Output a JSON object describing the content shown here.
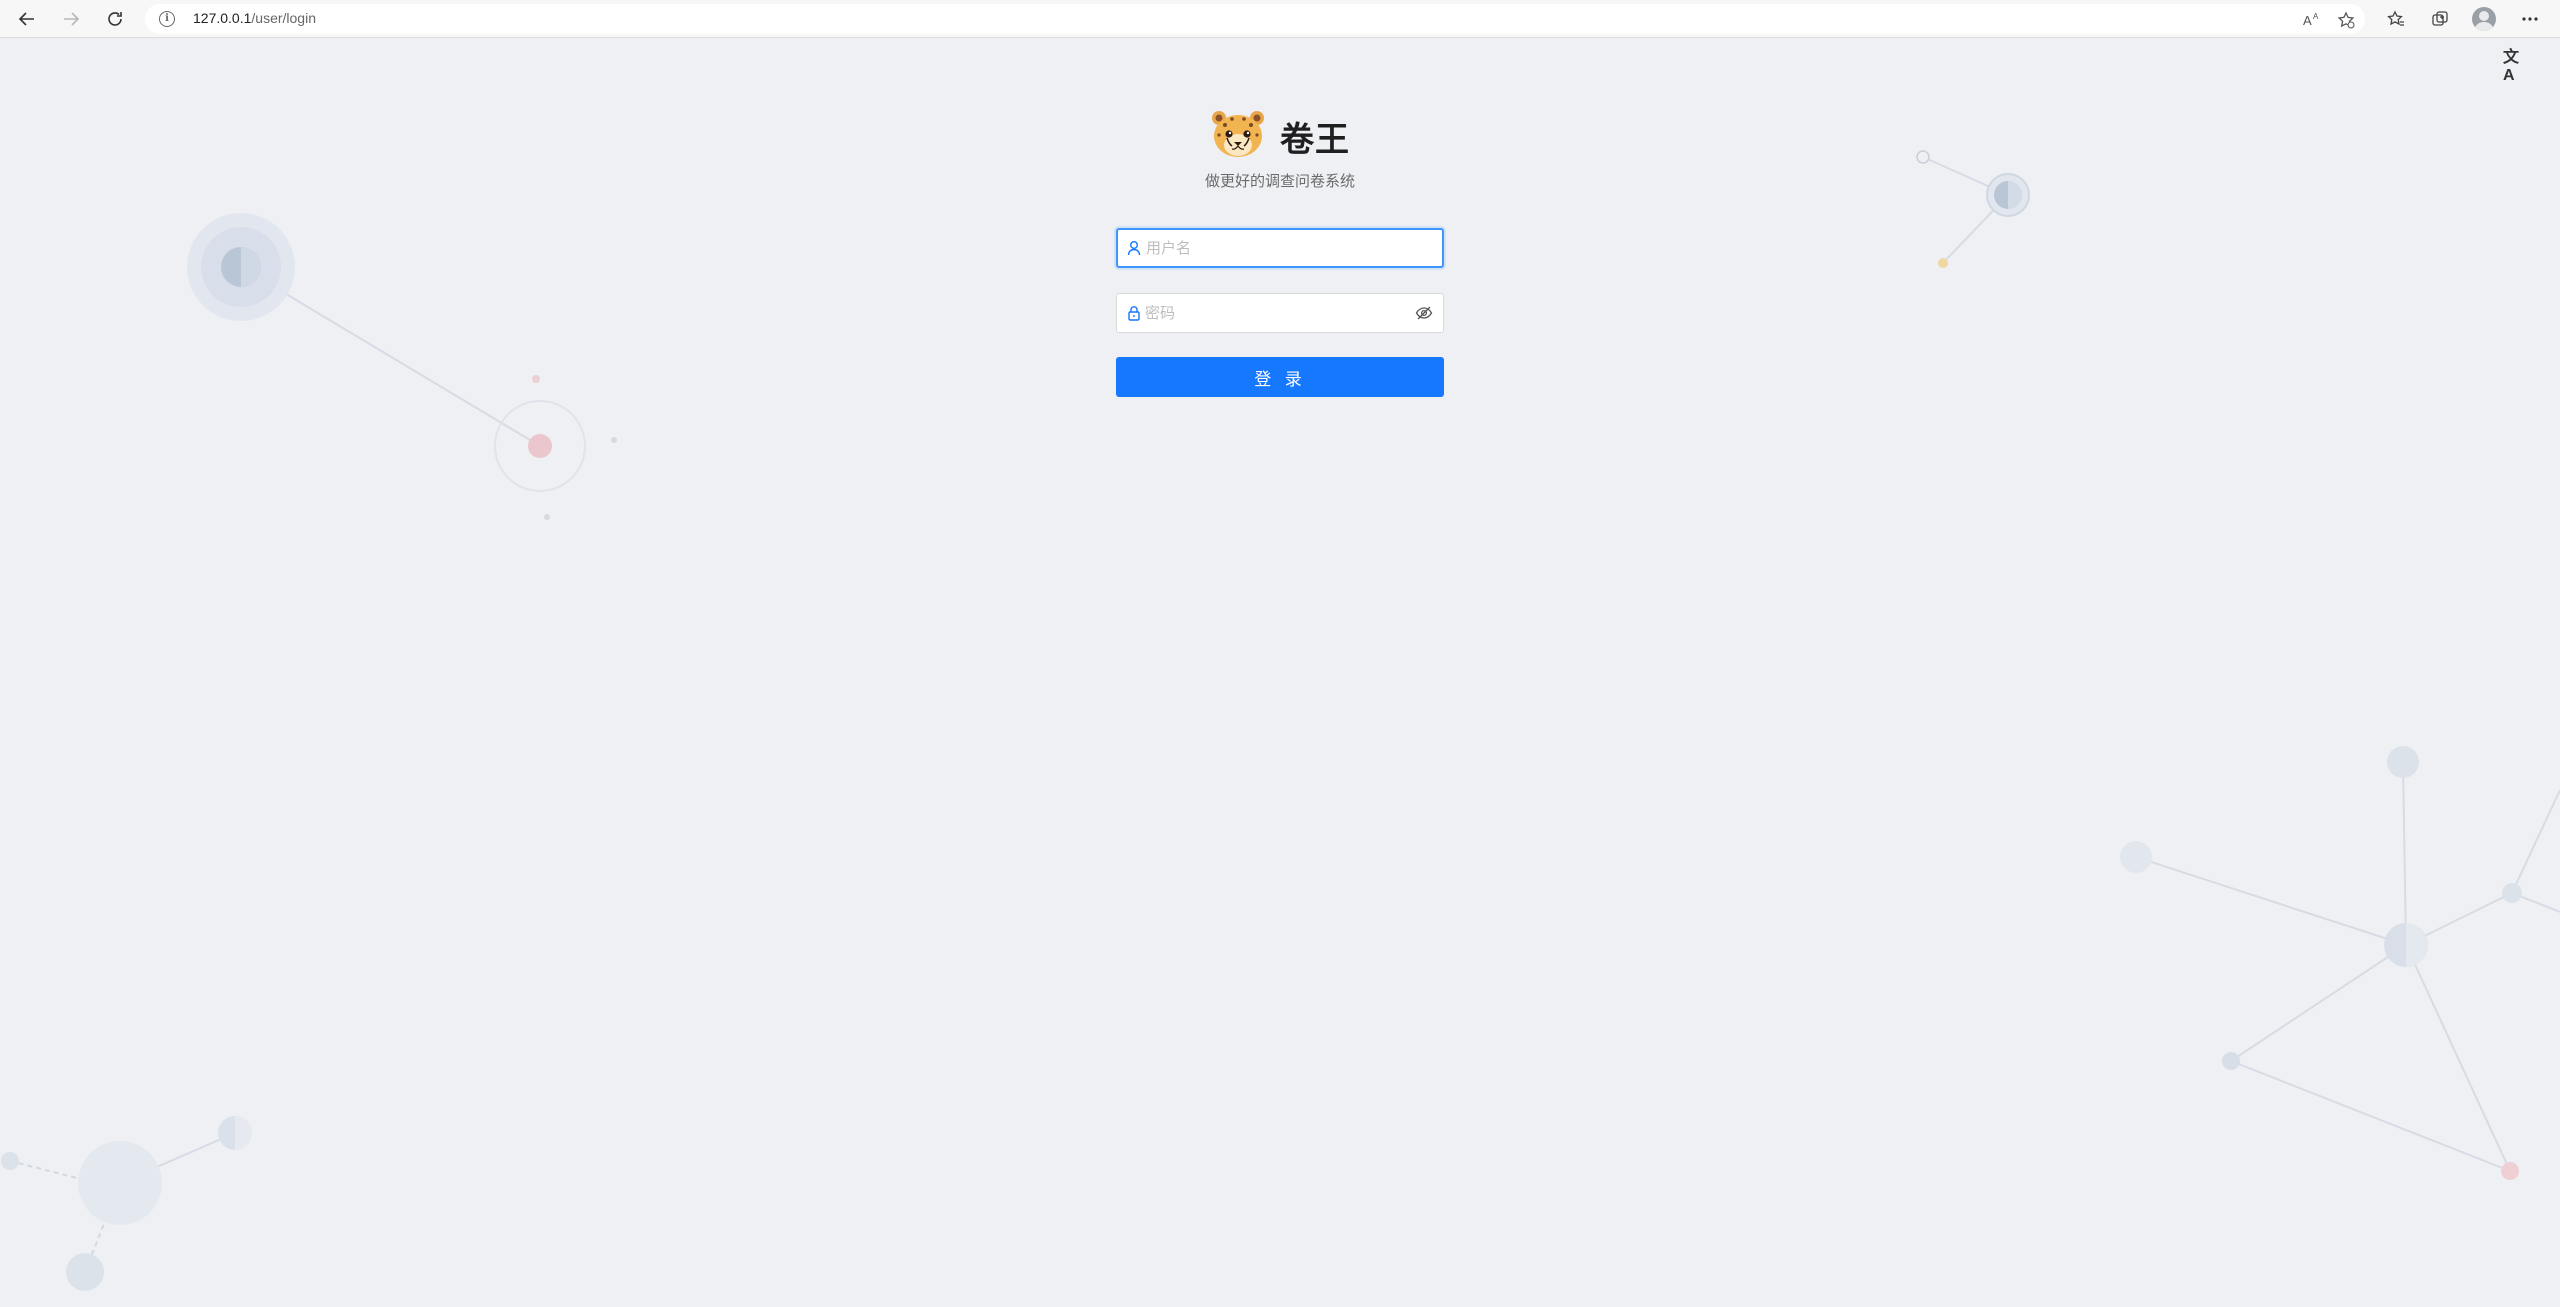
{
  "browser": {
    "url_host": "127.0.0.1",
    "url_path": "/user/login",
    "icons": [
      "back-icon",
      "forward-icon",
      "reload-icon",
      "info-icon",
      "read-aloud-icon",
      "add-favorite-icon",
      "favorites-icon",
      "collections-icon",
      "profile-avatar",
      "more-icon"
    ]
  },
  "page": {
    "translate_label": "文A",
    "brand": {
      "title": "卷王",
      "logo": "cheetah-logo"
    },
    "subtitle": "做更好的调查问卷系统",
    "username": {
      "placeholder": "用户名",
      "value": ""
    },
    "password": {
      "placeholder": "密码",
      "value": ""
    },
    "login_label": "登 录"
  },
  "colors": {
    "background": "#eef0f4",
    "primary": "#1677ff",
    "focus_border": "#4096ff"
  }
}
